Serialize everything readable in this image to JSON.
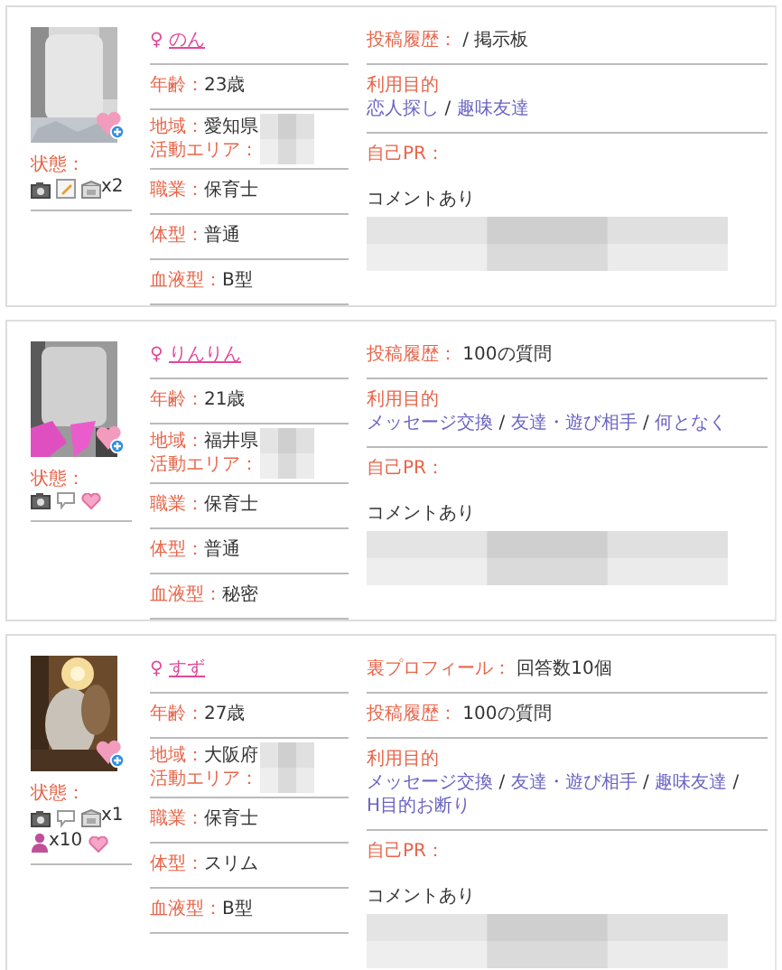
{
  "profiles": [
    {
      "gender": "♀",
      "name": "のん",
      "status_label": "状態：",
      "status": [
        {
          "kind": "camera"
        },
        {
          "kind": "memo"
        },
        {
          "kind": "mail",
          "count": "x2"
        }
      ],
      "details": [
        {
          "kind": "single",
          "label": "年齢：",
          "value": "23歳"
        },
        {
          "kind": "area",
          "label": "地域：",
          "value": "愛知県",
          "area_label": "活動エリア："
        },
        {
          "kind": "single",
          "label": "職業：",
          "value": "保育士"
        },
        {
          "kind": "single",
          "label": "体型：",
          "value": "普通"
        },
        {
          "kind": "single",
          "label": "血液型：",
          "value": "B型"
        }
      ],
      "sections": [
        {
          "kind": "field",
          "label": "投稿履歴：",
          "value": "/ 掲示板"
        },
        {
          "kind": "links",
          "label": "利用目的",
          "separator": "/",
          "links": [
            "恋人探し",
            "趣味友達"
          ]
        },
        {
          "kind": "pr",
          "label": "自己PR：",
          "comment": "コメントあり"
        }
      ]
    },
    {
      "gender": "♀",
      "name": "りんりん",
      "status_label": "状態：",
      "status": [
        {
          "kind": "camera"
        },
        {
          "kind": "bubble"
        },
        {
          "kind": "heart"
        }
      ],
      "details": [
        {
          "kind": "single",
          "label": "年齢：",
          "value": "21歳"
        },
        {
          "kind": "area",
          "label": "地域：",
          "value": "福井県",
          "area_label": "活動エリア："
        },
        {
          "kind": "single",
          "label": "職業：",
          "value": "保育士"
        },
        {
          "kind": "single",
          "label": "体型：",
          "value": "普通"
        },
        {
          "kind": "single",
          "label": "血液型：",
          "value": "秘密"
        }
      ],
      "sections": [
        {
          "kind": "field",
          "label": "投稿履歴：",
          "value": "100の質問"
        },
        {
          "kind": "links",
          "label": "利用目的",
          "separator": "/",
          "links": [
            "メッセージ交換",
            "友達・遊び相手",
            "何となく"
          ]
        },
        {
          "kind": "pr",
          "label": "自己PR：",
          "comment": "コメントあり"
        }
      ]
    },
    {
      "gender": "♀",
      "name": "すず",
      "status_label": "状態：",
      "status": [
        {
          "kind": "camera"
        },
        {
          "kind": "bubble"
        },
        {
          "kind": "mail",
          "count": "x1"
        },
        {
          "kind": "person",
          "count": "x10"
        },
        {
          "kind": "heart"
        }
      ],
      "details": [
        {
          "kind": "single",
          "label": "年齢：",
          "value": "27歳"
        },
        {
          "kind": "area",
          "label": "地域：",
          "value": "大阪府",
          "area_label": "活動エリア："
        },
        {
          "kind": "single",
          "label": "職業：",
          "value": "保育士"
        },
        {
          "kind": "single",
          "label": "体型：",
          "value": "スリム"
        },
        {
          "kind": "single",
          "label": "血液型：",
          "value": "B型"
        }
      ],
      "sections": [
        {
          "kind": "field",
          "label": "裏プロフィール：",
          "value": "回答数10個"
        },
        {
          "kind": "field",
          "label": "投稿履歴：",
          "value": "100の質問"
        },
        {
          "kind": "links",
          "label": "利用目的",
          "separator": "/",
          "links": [
            "メッセージ交換",
            "友達・遊び相手",
            "趣味友達",
            "H目的お断り"
          ]
        },
        {
          "kind": "pr",
          "label": "自己PR：",
          "comment": "コメントあり"
        }
      ]
    }
  ]
}
